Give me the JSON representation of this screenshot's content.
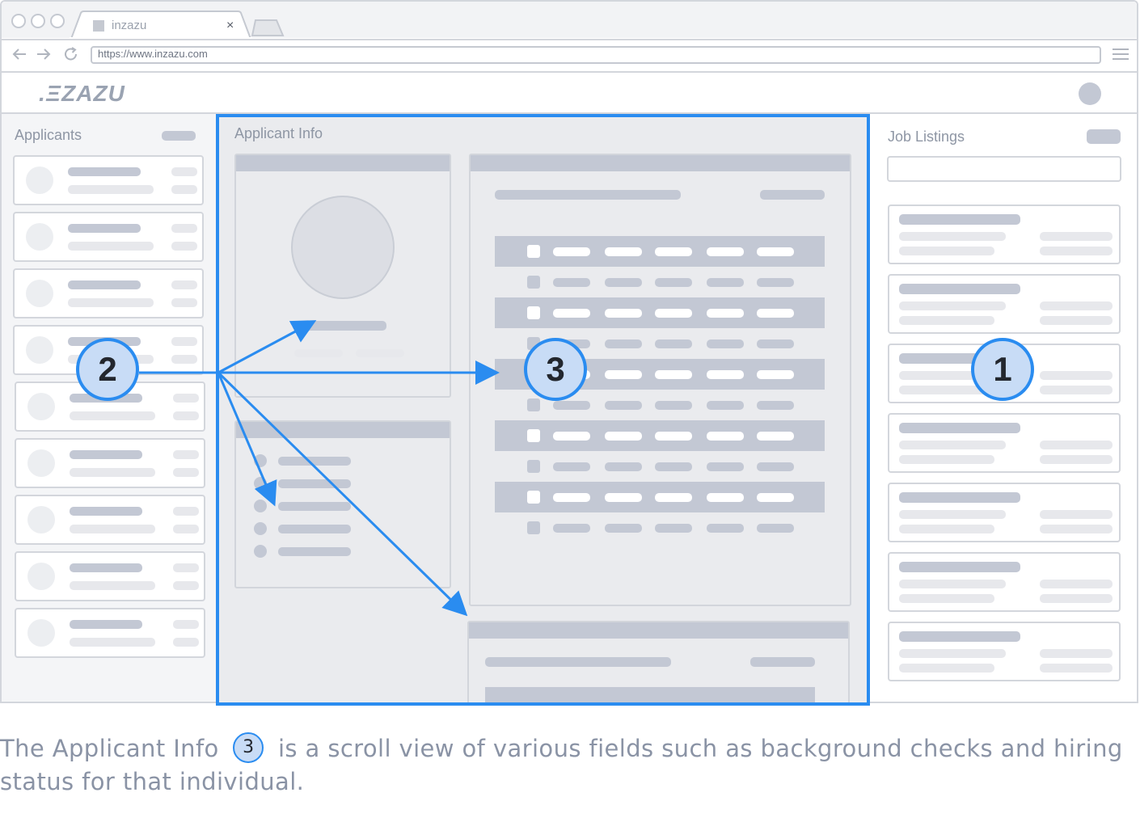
{
  "browser": {
    "tab_title": "inzazu",
    "tab_close": "×",
    "url": "https://www.inzazu.com"
  },
  "app": {
    "logo": ".ΞZAZU"
  },
  "applicants_panel": {
    "title": "Applicants",
    "card_count": 9
  },
  "applicant_info": {
    "title": "Applicant Info"
  },
  "job_listings": {
    "title": "Job Listings",
    "card_count": 7
  },
  "callouts": [
    {
      "number": "1",
      "target": "job-listings"
    },
    {
      "number": "2",
      "target": "applicants"
    },
    {
      "number": "3",
      "target": "applicant-info"
    }
  ],
  "caption": {
    "before": "The Applicant Info",
    "badge": "3",
    "after": "is a scroll view of various fields such as background checks and hiring status for that individual."
  },
  "colors": {
    "highlight": "#2a8cf0",
    "callout_fill": "#c8dcf6",
    "placeholder_dark": "#c3c8d4",
    "placeholder_light": "#e7e8ec",
    "caption_text": "#8a93a5"
  },
  "icons": [
    "back-arrow-icon",
    "forward-arrow-icon",
    "reload-icon",
    "hamburger-menu-icon",
    "favicon-icon",
    "close-icon",
    "avatar"
  ]
}
